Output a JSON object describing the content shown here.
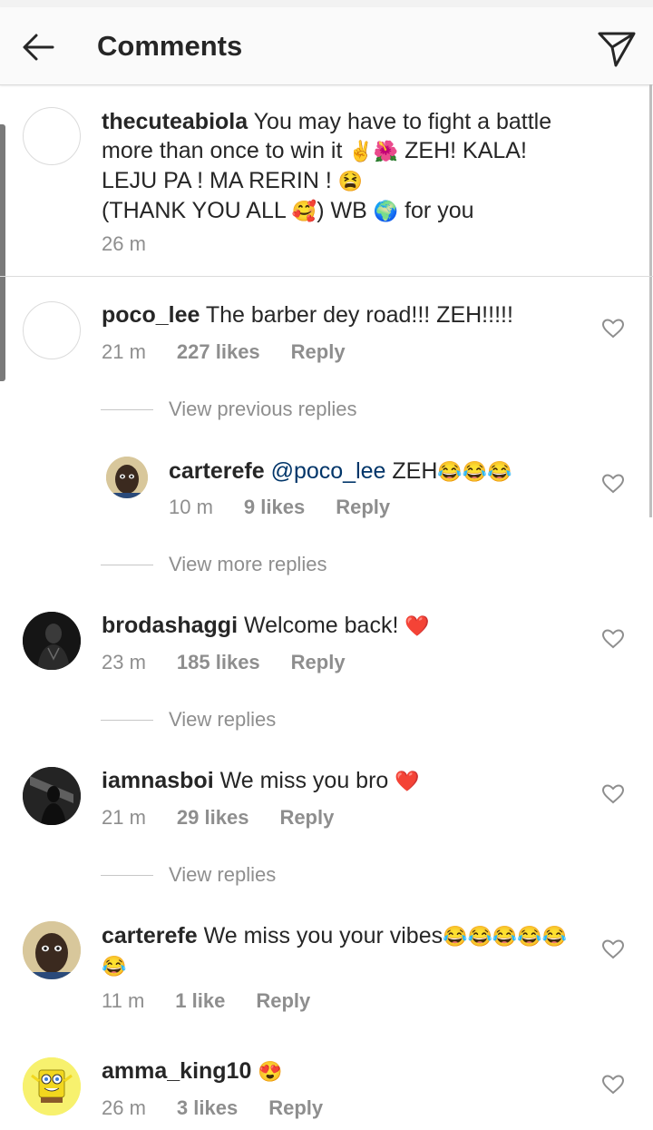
{
  "header": {
    "title": "Comments"
  },
  "caption": {
    "username": "thecuteabiola",
    "line1": "You may have to fight a battle",
    "line2a": "more than once to win it",
    "line2b": "ZEH! KALA!",
    "line3": "LEJU PA ! MA RERIN !",
    "line4a": "(THANK YOU ALL",
    "line4b": ") WB",
    "line4c": "for you",
    "time": "26 m"
  },
  "comments": [
    {
      "username": "poco_lee",
      "text": "The barber dey road!!! ZEH!!!!!",
      "time": "21 m",
      "likes": "227 likes",
      "reply": "Reply"
    },
    {
      "username": "carterefe",
      "mention": "@poco_lee",
      "text": "ZEH",
      "time": "10 m",
      "likes": "9 likes",
      "reply": "Reply"
    },
    {
      "username": "brodashaggi",
      "text": "Welcome back!",
      "time": "23 m",
      "likes": "185 likes",
      "reply": "Reply"
    },
    {
      "username": "iamnasboi",
      "text": "We miss you bro",
      "time": "21 m",
      "likes": "29 likes",
      "reply": "Reply"
    },
    {
      "username": "carterefe",
      "text": "We miss you your vibes",
      "time": "11 m",
      "likes": "1 like",
      "reply": "Reply"
    },
    {
      "username": "amma_king10",
      "text": "",
      "time": "26 m",
      "likes": "3 likes",
      "reply": "Reply"
    }
  ],
  "threads": {
    "view_previous": "View previous replies",
    "view_more": "View more replies",
    "view_replies_1": "View replies",
    "view_replies_2": "View replies"
  },
  "icons": {
    "back": "arrow-left-icon",
    "share": "paper-plane-icon",
    "like": "heart-outline-icon"
  }
}
